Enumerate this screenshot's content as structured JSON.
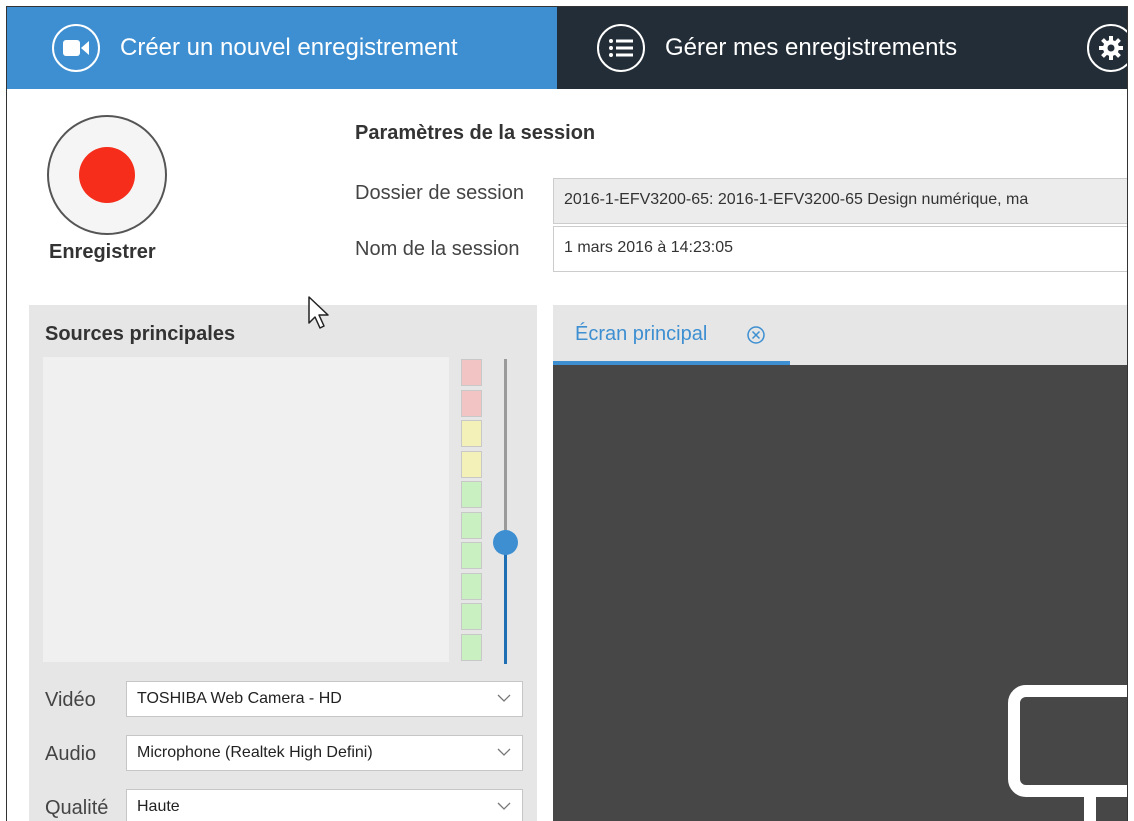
{
  "tabs": {
    "create": {
      "label": "Créer un nouvel enregistrement",
      "icon": "video-camera-icon",
      "active": true
    },
    "manage": {
      "label": "Gérer mes enregistrements",
      "icon": "list-icon",
      "active": false
    },
    "settings": {
      "icon": "gear-icon"
    }
  },
  "record": {
    "label": "Enregistrer",
    "icon": "record-icon"
  },
  "session": {
    "title": "Paramètres de la session",
    "folder_label": "Dossier de session",
    "folder_value": "2016-1-EFV3200-65: 2016-1-EFV3200-65 Design numérique, ma",
    "name_label": "Nom de la session",
    "name_value": "1 mars 2016 à 14:23:05"
  },
  "sources": {
    "title": "Sources principales",
    "level_meter": [
      "red",
      "red",
      "yellow",
      "yellow",
      "green",
      "green",
      "green",
      "green",
      "green",
      "green"
    ],
    "volume_level": 0.4,
    "video_label": "Vidéo",
    "video_value": "TOSHIBA Web Camera - HD",
    "audio_label": "Audio",
    "audio_value": "Microphone (Realtek High Defini)",
    "quality_label": "Qualité",
    "quality_value": "Haute"
  },
  "screen": {
    "tab_label": "Écran principal",
    "close_icon": "close-circle-icon",
    "placeholder_icon": "monitor-icon"
  },
  "colors": {
    "accent": "#3d8fd1",
    "topbar": "#232d38",
    "record": "#f52d1a",
    "meter_red": "#f2c4c4",
    "meter_yellow": "#f3f1b8",
    "meter_green": "#c8f0c0"
  }
}
